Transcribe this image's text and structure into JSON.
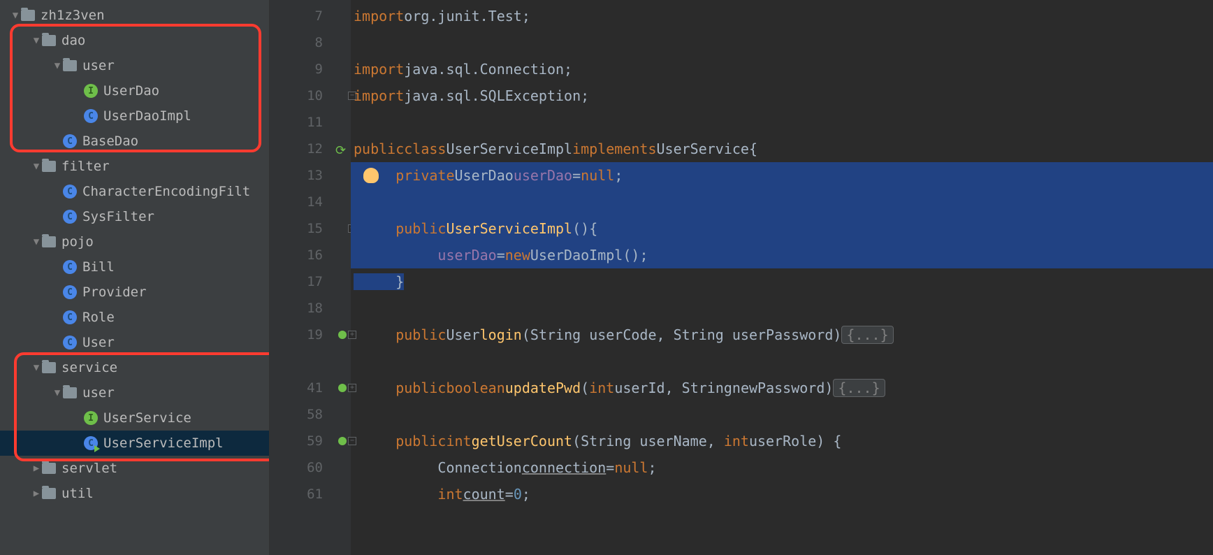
{
  "tree": {
    "root": "zh1z3ven",
    "dao": "dao",
    "dao_user": "user",
    "UserDao": "UserDao",
    "UserDaoImpl": "UserDaoImpl",
    "BaseDao": "BaseDao",
    "filter": "filter",
    "CharacterEncodingFilter": "CharacterEncodingFilt",
    "SysFilter": "SysFilter",
    "pojo": "pojo",
    "Bill": "Bill",
    "Provider": "Provider",
    "Role": "Role",
    "User": "User",
    "service": "service",
    "service_user": "user",
    "UserService": "UserService",
    "UserServiceImpl": "UserServiceImpl",
    "servlet": "servlet",
    "util": "util"
  },
  "gutter": {
    "l7": "7",
    "l8": "8",
    "l9": "9",
    "l10": "10",
    "l11": "11",
    "l12": "12",
    "l13": "13",
    "l14": "14",
    "l15": "15",
    "l16": "16",
    "l17": "17",
    "l18": "18",
    "l19": "19",
    "l41": "41",
    "l58": "58",
    "l59": "59",
    "l60": "60",
    "l61": "61"
  },
  "code": {
    "import_kw": "import",
    "junit": "org.junit.",
    "Test": "Test",
    "semi": ";",
    "conn_pkg": "java.sql.Connection",
    "sqle_pkg": "java.sql.SQLException",
    "public_kw": "public",
    "class_kw": "class",
    "UserServiceImpl": "UserServiceImpl",
    "implements_kw": "implements",
    "UserService": "UserService",
    "lbrace": "{",
    "rbrace": "}",
    "private_kw": "private",
    "UserDao": "UserDao",
    "userDao_field": "userDao",
    "eq": "=",
    "null_kw": "null",
    "ctor_parens": "()",
    "new_kw": "new",
    "UserDaoImpl": "UserDaoImpl",
    "User": "User",
    "login": "login",
    "login_params": "(String userCode, String userPassword)",
    "folded": "{...}",
    "boolean_kw": "boolean",
    "updatePwd": "updatePwd",
    "updatePwd_params_open": "(",
    "int_kw": "int",
    "userId": "userId",
    "comma": ", ",
    "String": "String",
    "newPassword": "newPassword",
    "rparen": ")",
    "getUserCount": "getUserCount",
    "getUserCount_p1": "(String userName, ",
    "userRole": "userRole",
    "space_lbrace": " {",
    "Connection": "Connection",
    "connection_var": "connection",
    "count_var": "count",
    "zero": "0"
  }
}
